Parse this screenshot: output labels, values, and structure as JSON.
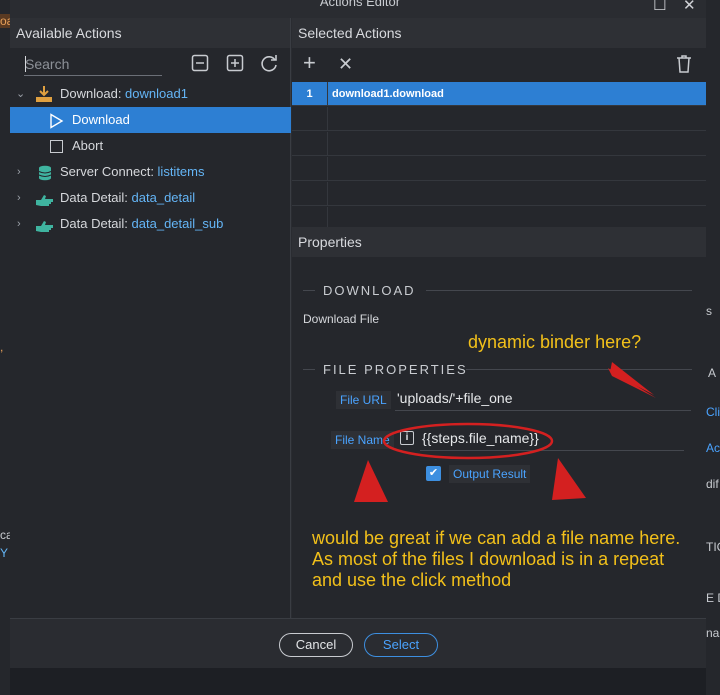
{
  "dialog": {
    "title": "Actions Editor"
  },
  "background": {
    "left_fragments": [
      "oa",
      ",",
      "ca",
      "Y"
    ],
    "right_fragments": [
      "s",
      "A",
      "Cli",
      "Ac",
      "dif",
      "TIC",
      "E D",
      "na"
    ]
  },
  "available_actions": {
    "heading": "Available Actions",
    "search_placeholder": "Search",
    "tree": [
      {
        "prefix": "Download: ",
        "ref": "download1",
        "icon": "download-icon",
        "expanded": true
      },
      {
        "label": "Download",
        "icon": "play-icon",
        "selected": true
      },
      {
        "label": "Abort",
        "icon": "stop-icon"
      },
      {
        "prefix": "Server Connect: ",
        "ref": "listitems",
        "icon": "database-icon"
      },
      {
        "prefix": "Data Detail: ",
        "ref": "data_detail",
        "icon": "pointer-hand-icon"
      },
      {
        "prefix": "Data Detail: ",
        "ref": "data_detail_sub",
        "icon": "pointer-hand-icon"
      }
    ]
  },
  "selected_actions": {
    "heading": "Selected Actions",
    "rows": [
      {
        "num": "1",
        "label": "download1.download"
      }
    ]
  },
  "properties": {
    "heading": "Properties",
    "section_download": "DOWNLOAD",
    "download_desc": "Download File",
    "section_file": "FILE PROPERTIES",
    "file_url_label": "File URL",
    "file_url_value": "'uploads/'+file_one",
    "file_name_label": "File Name",
    "file_name_value": "{{steps.file_name}}",
    "output_result_label": "Output Result"
  },
  "annotations": {
    "top": "dynamic binder here?",
    "bottom": "would be great if we can add a file name here. As most of the files I download is in a repeat and use the click method"
  },
  "footer": {
    "cancel_label": "Cancel",
    "select_label": "Select"
  },
  "colors": {
    "accent": "#2d7fd3",
    "annotation": "#f2c01a",
    "annotation_marks": "#d42020"
  }
}
